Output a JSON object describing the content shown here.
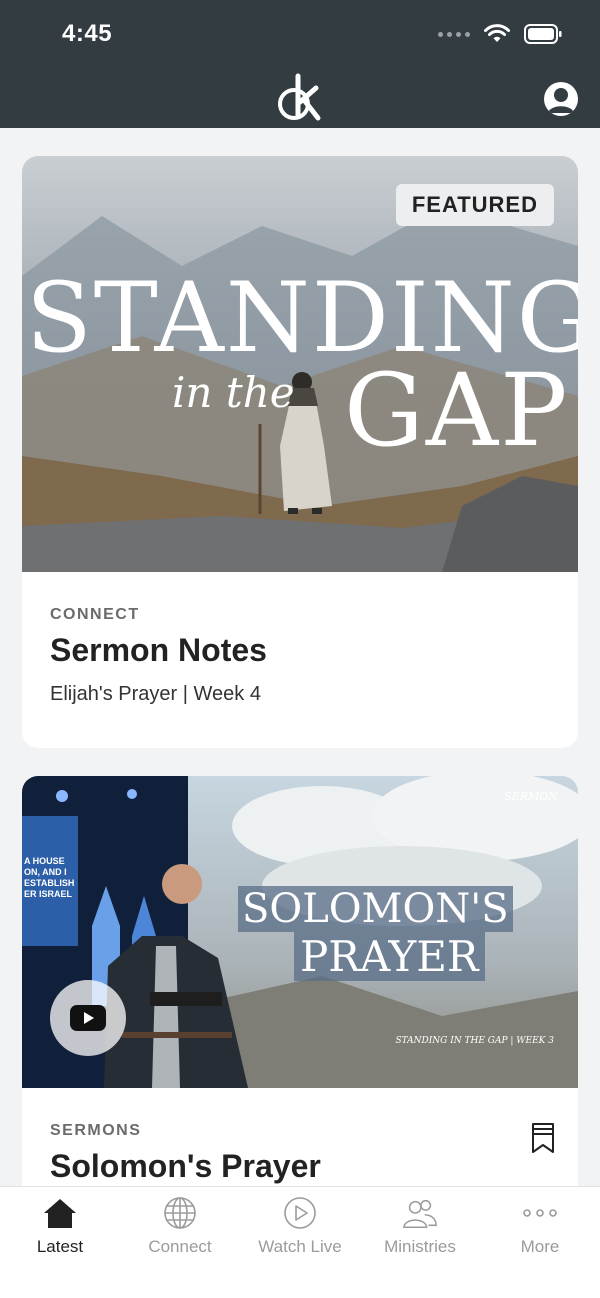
{
  "status_bar": {
    "time": "4:45"
  },
  "header": {
    "logo_icon": "k-logo-icon",
    "profile_icon": "user-avatar-icon"
  },
  "featured_card": {
    "badge": "FEATURED",
    "image_text": {
      "line1": "STANDING",
      "line2": "in the",
      "line3": "GAP"
    },
    "category": "CONNECT",
    "title": "Sermon Notes",
    "subtitle": "Elijah's Prayer | Week 4"
  },
  "sermon_card": {
    "image_text": {
      "corner": "SERMON",
      "line1": "SOLOMON'S",
      "line2": "PRAYER",
      "footer": "STANDING IN THE GAP | WEEK 3",
      "screen_text": "A HOUSE ON, AND I ESTABLISH ER ISRAEL"
    },
    "category": "SERMONS",
    "title": "Solomon's Prayer",
    "play_icon": "youtube-play-icon",
    "bookmark_icon": "bookmark-icon"
  },
  "tabs": [
    {
      "label": "Latest",
      "icon": "home-icon",
      "active": true
    },
    {
      "label": "Connect",
      "icon": "globe-icon",
      "active": false
    },
    {
      "label": "Watch Live",
      "icon": "play-circle-icon",
      "active": false
    },
    {
      "label": "Ministries",
      "icon": "people-icon",
      "active": false
    },
    {
      "label": "More",
      "icon": "more-dots-icon",
      "active": false
    }
  ]
}
